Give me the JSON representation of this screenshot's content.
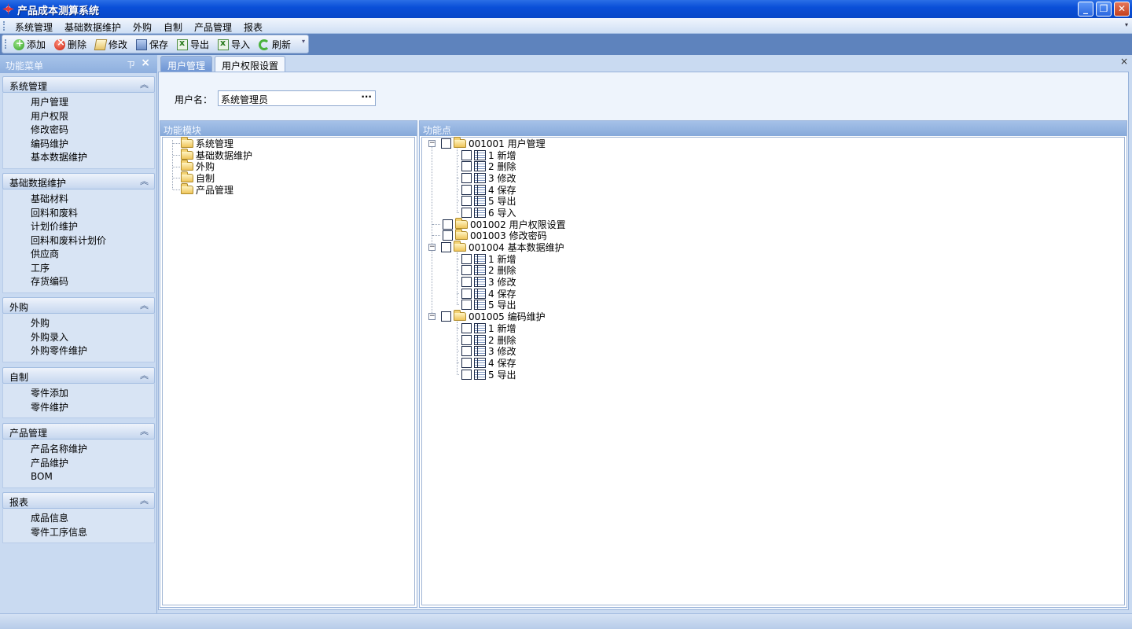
{
  "window": {
    "title": "产品成本测算系统",
    "minimize": "_",
    "restore": "❐",
    "close": "✕"
  },
  "menu": [
    "系统管理",
    "基础数据维护",
    "外购",
    "自制",
    "产品管理",
    "报表"
  ],
  "toolbar": {
    "add": "添加",
    "delete": "删除",
    "edit": "修改",
    "save": "保存",
    "export": "导出",
    "import": "导入",
    "refresh": "刷新"
  },
  "sidebar": {
    "title": "功能菜单",
    "groups": [
      {
        "title": "系统管理",
        "items": [
          "用户管理",
          "用户权限",
          "修改密码",
          "编码维护",
          "基本数据维护"
        ]
      },
      {
        "title": "基础数据维护",
        "items": [
          "基础材料",
          "回料和废料",
          "计划价维护",
          "回料和废料计划价",
          "供应商",
          "工序",
          "存货编码"
        ]
      },
      {
        "title": "外购",
        "items": [
          "外购",
          "外购录入",
          "外购零件维护"
        ]
      },
      {
        "title": "自制",
        "items": [
          "零件添加",
          "零件维护"
        ]
      },
      {
        "title": "产品管理",
        "items": [
          "产品名称维护",
          "产品维护",
          "BOM"
        ]
      },
      {
        "title": "报表",
        "items": [
          "成品信息",
          "零件工序信息"
        ]
      }
    ]
  },
  "tabs": [
    "用户管理",
    "用户权限设置"
  ],
  "form": {
    "username_label": "用户名：",
    "username_value": "系统管理员",
    "browse": "···"
  },
  "modules_panel": {
    "title": "功能模块",
    "items": [
      "系统管理",
      "基础数据维护",
      "外购",
      "自制",
      "产品管理"
    ]
  },
  "functions_panel": {
    "title": "功能点",
    "nodes": [
      {
        "label": "001001 用户管理",
        "children": [
          "1 新增",
          "2 删除",
          "3 修改",
          "4 保存",
          "5 导出",
          "6 导入"
        ]
      },
      {
        "label": "001002 用户权限设置",
        "children": []
      },
      {
        "label": "001003 修改密码",
        "children": []
      },
      {
        "label": "001004 基本数据维护",
        "children": [
          "1 新增",
          "2 删除",
          "3 修改",
          "4 保存",
          "5 导出"
        ]
      },
      {
        "label": "001005 编码维护",
        "children": [
          "1 新增",
          "2 删除",
          "3 修改",
          "4 保存",
          "5 导出"
        ]
      }
    ]
  }
}
